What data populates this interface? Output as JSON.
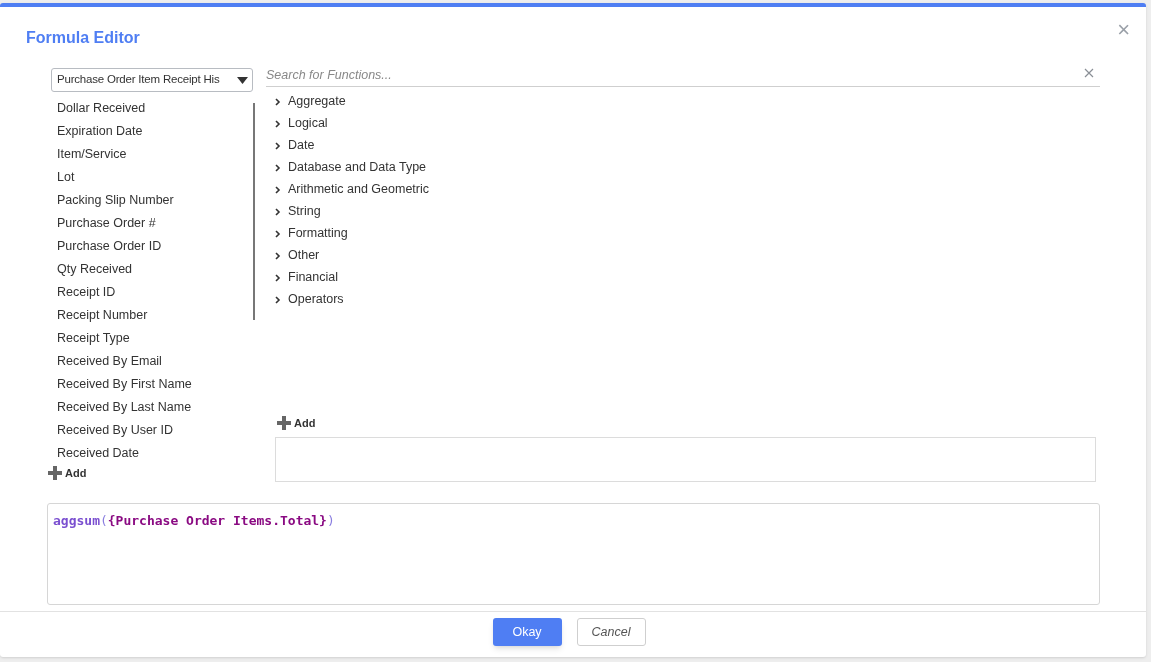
{
  "dialog": {
    "title": "Formula Editor",
    "close": "×"
  },
  "field_source": {
    "value": "Purchase Order Item Receipt His"
  },
  "fields": [
    "Dollar Received",
    "Expiration Date",
    "Item/Service",
    "Lot",
    "Packing Slip Number",
    "Purchase Order #",
    "Purchase Order ID",
    "Qty Received",
    "Receipt ID",
    "Receipt Number",
    "Receipt Type",
    "Received By Email",
    "Received By First Name",
    "Received By Last Name",
    "Received By User ID",
    "Received Date"
  ],
  "fields_add": "Add",
  "function_search": {
    "placeholder": "Search for Functions..."
  },
  "function_groups": [
    {
      "label": "Aggregate",
      "expanded": false
    },
    {
      "label": "Logical",
      "expanded": false
    },
    {
      "label": "Date",
      "expanded": false
    },
    {
      "label": "Database and Data Type",
      "expanded": false
    },
    {
      "label": "Arithmetic and Geometric",
      "expanded": false
    },
    {
      "label": "String",
      "expanded": false
    },
    {
      "label": "Formatting",
      "expanded": false
    },
    {
      "label": "Other",
      "expanded": false
    },
    {
      "label": "Financial",
      "expanded": false
    },
    {
      "label": "Operators",
      "expanded": false
    }
  ],
  "functions_add": "Add",
  "formula": [
    {
      "kind": "function",
      "text": "aggsum"
    },
    {
      "kind": "paren",
      "text": "("
    },
    {
      "kind": "field",
      "text": "{Purchase Order Items.Total}"
    },
    {
      "kind": "paren",
      "text": ")"
    }
  ],
  "buttons": [
    {
      "label": "Okay",
      "kind": "primary"
    },
    {
      "label": "Cancel",
      "kind": "secondary"
    }
  ]
}
